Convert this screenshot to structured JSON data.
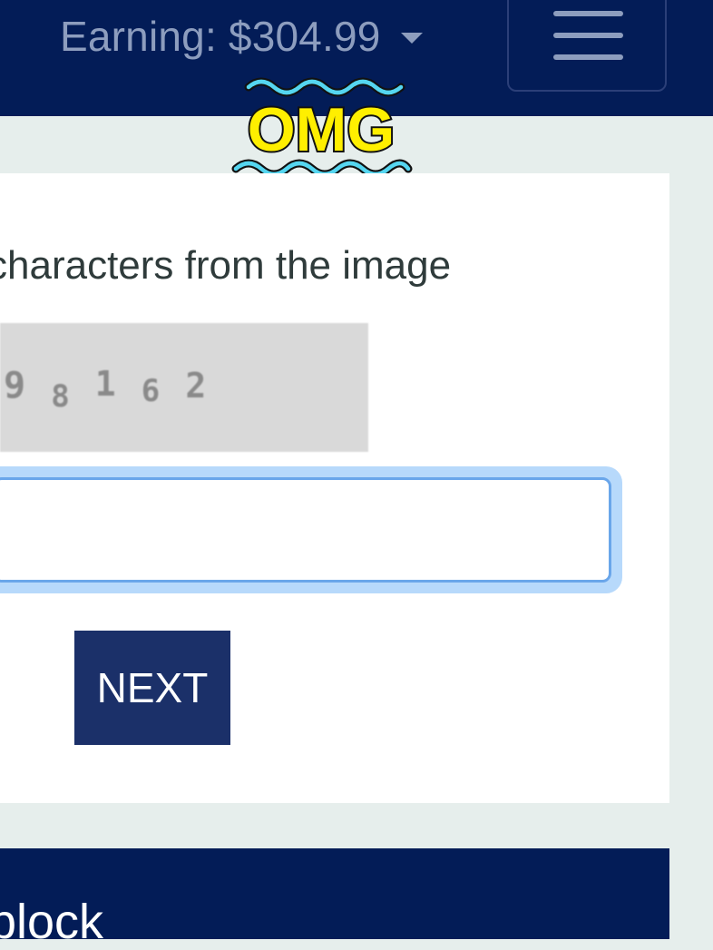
{
  "header": {
    "earning_label": "Earning: $304.99",
    "menu_icon": "hamburger-icon",
    "background_color": "#031c57"
  },
  "sticker": {
    "text": "OMG",
    "fill_color": "#ffef00",
    "wave_color": "#55d6f0"
  },
  "task": {
    "instruction": "characters from the image",
    "captcha_digits": [
      "9",
      "8",
      "1",
      "6",
      "2"
    ],
    "input_value": "",
    "next_label": "NEXT",
    "next_color": "#1b3069"
  },
  "bottom_panel": {
    "text": "block"
  }
}
